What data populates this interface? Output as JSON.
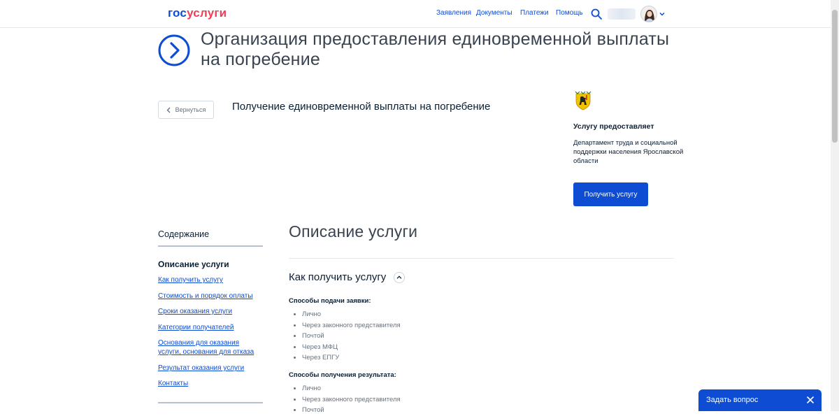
{
  "header": {
    "logo_part1": "гос",
    "logo_part2": "услуги",
    "nav": [
      "Заявления",
      "Документы",
      "Платежи",
      "Помощь"
    ]
  },
  "page": {
    "title": "Организация предоставления единовременной выплаты на погребение",
    "back_label": "Вернуться",
    "subtitle": "Получение единовременной выплаты на погребение"
  },
  "provider": {
    "label": "Услугу предоставляет",
    "name": "Департамент труда и социальной поддержки населения Ярославской области",
    "button": "Получить услугу"
  },
  "toc": {
    "title": "Содержание",
    "current": "Описание услуги",
    "links": [
      "Как получить услугу",
      "Стоимость и порядок оплаты",
      "Сроки оказания услуги",
      "Категории получателей",
      "Основания для оказания услуги, основания для отказа",
      "Результат оказания услуги",
      "Контакты"
    ]
  },
  "main": {
    "section_title": "Описание услуги",
    "accordion_title": "Как получить услугу",
    "submit_methods_label": "Способы подачи заявки:",
    "submit_methods": [
      "Лично",
      "Через законного представителя",
      "Почтой",
      "Через МФЦ",
      "Через ЕПГУ"
    ],
    "result_methods_label": "Способы получения результата:",
    "result_methods": [
      "Лично",
      "Через законного представителя",
      "Почтой"
    ]
  },
  "chat": {
    "label": "Задать вопрос"
  },
  "colors": {
    "accent": "#0d4cd3",
    "logo_red": "#ee3f58",
    "text": "#0b1f33",
    "muted": "#66727f"
  }
}
